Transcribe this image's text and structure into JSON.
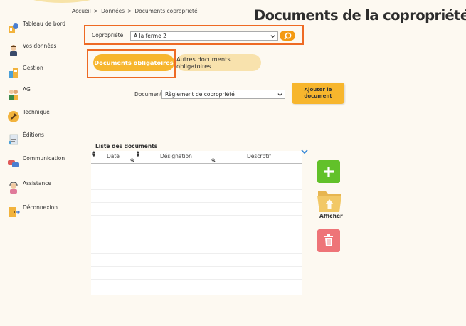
{
  "sidebar": {
    "items": [
      {
        "label": "Tableau de bord"
      },
      {
        "label": "Vos données"
      },
      {
        "label": "Gestion"
      },
      {
        "label": "AG"
      },
      {
        "label": "Technique"
      },
      {
        "label": "Éditions"
      },
      {
        "label": "Communication"
      },
      {
        "label": "Assistance"
      },
      {
        "label": "Déconnexion"
      }
    ]
  },
  "breadcrumb": {
    "home": "Accueil",
    "data": "Données",
    "current": "Documents copropriété",
    "sep": ">"
  },
  "page_title": "Documents de la copropriété",
  "copro": {
    "label": "Copropriété",
    "selected": "A la ferme 2"
  },
  "tabs": {
    "active": "Documents obligatoires",
    "other": "Autres documents obligatoires"
  },
  "document": {
    "label": "Document",
    "selected": "Règlement de copropriété",
    "add_line1": "Ajouter le",
    "add_line2": "document"
  },
  "list": {
    "title": "Liste des documents",
    "columns": [
      "Date",
      "Désignation",
      "Descrptif"
    ]
  },
  "actions": {
    "show_label": "Afficher"
  },
  "colors": {
    "accent_orange": "#f7b62d",
    "highlight_frame": "#ee6a24",
    "add_green": "#62c12a",
    "delete_red": "#ee7478"
  }
}
